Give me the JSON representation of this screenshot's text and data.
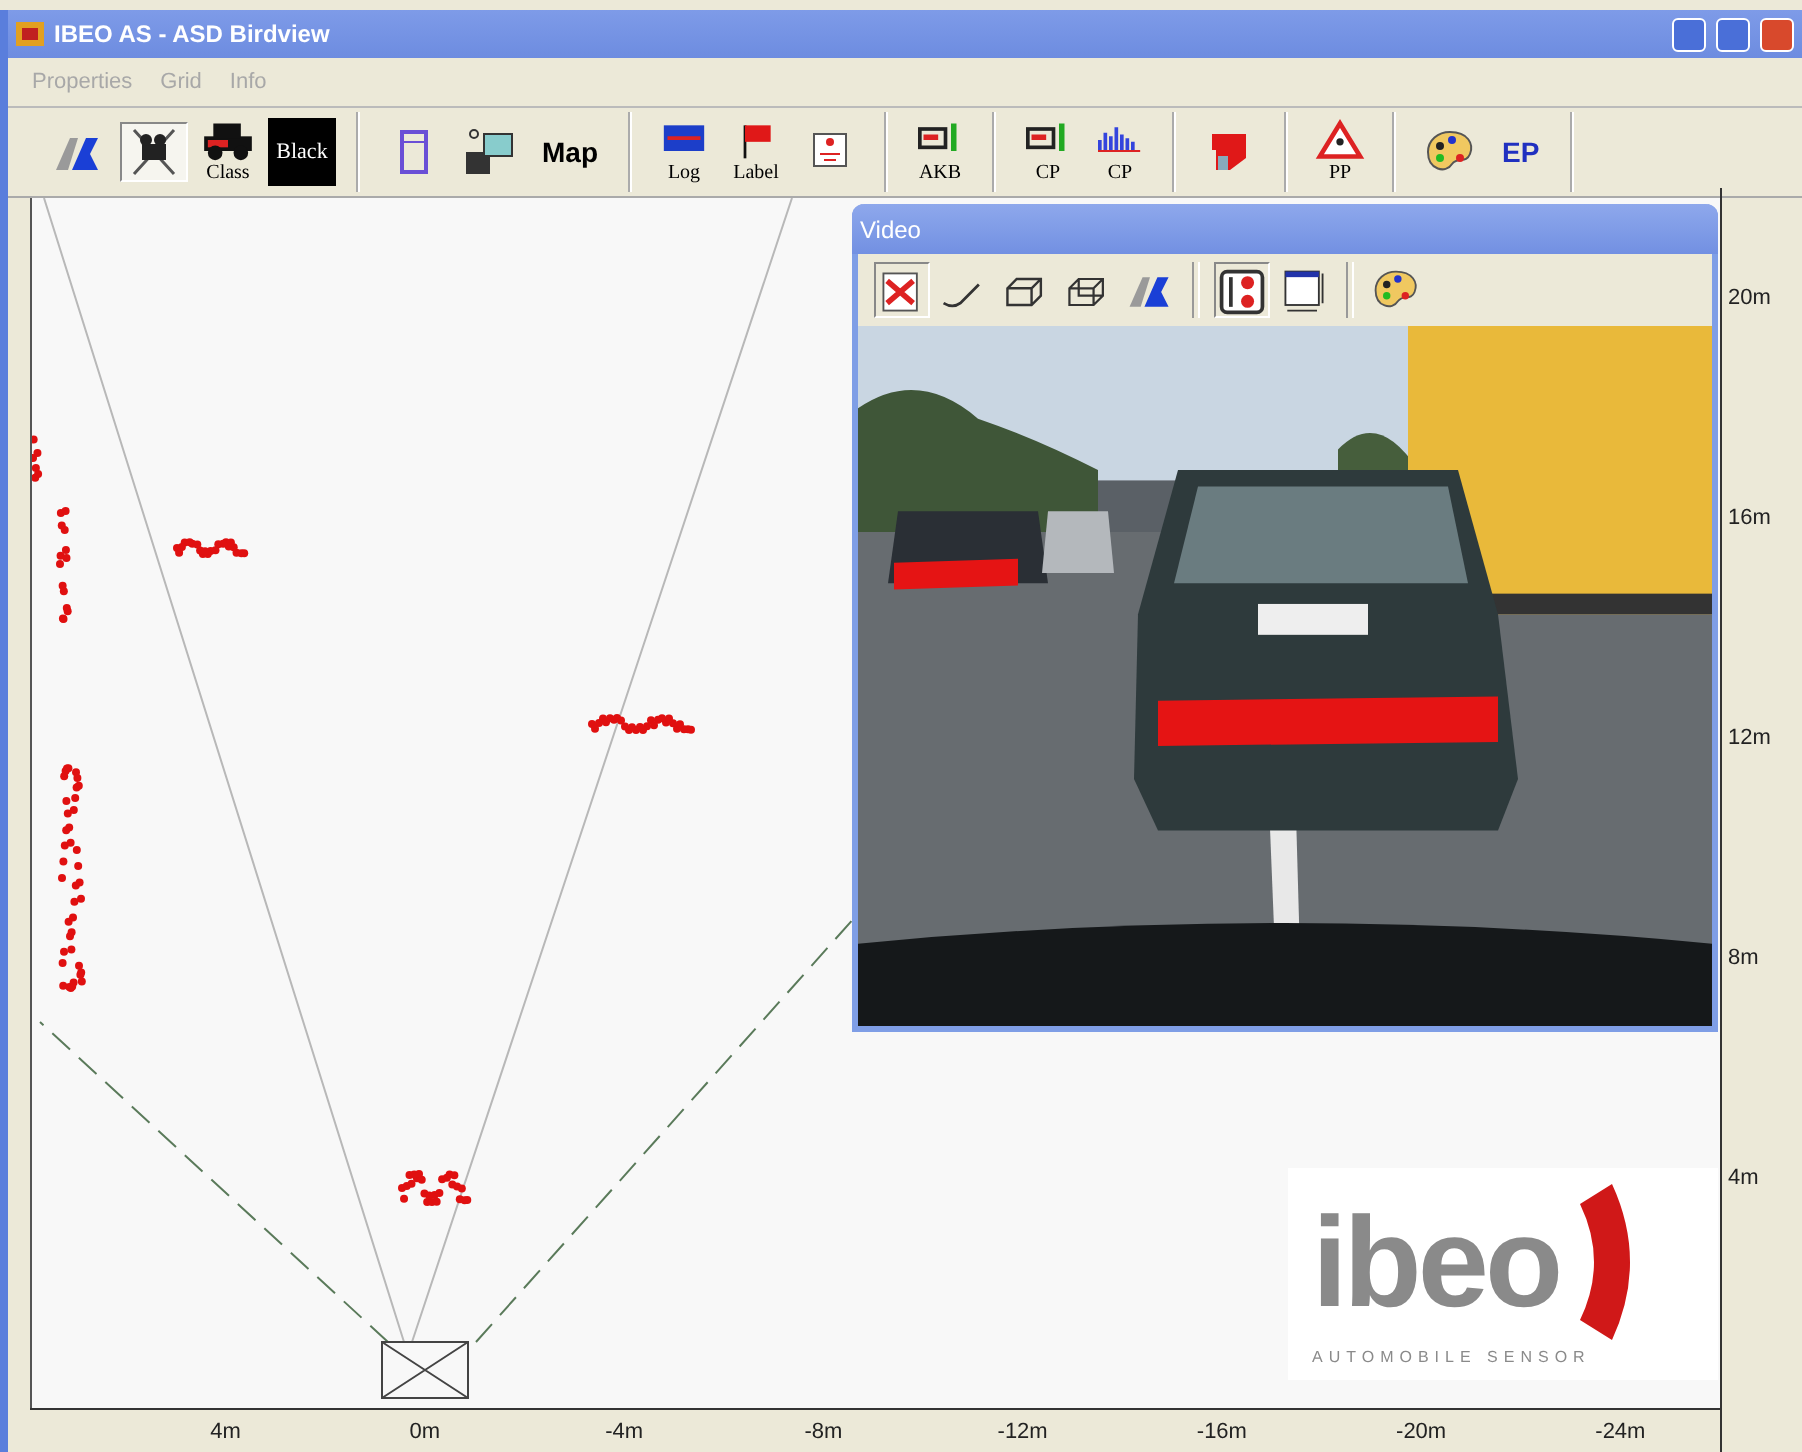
{
  "window": {
    "title": "IBEO AS - ASD Birdview"
  },
  "menu": [
    {
      "label": "Properties"
    },
    {
      "label": "Grid"
    },
    {
      "label": "Info"
    }
  ],
  "toolbar": {
    "groups": [
      [
        {
          "kind": "icon",
          "selected": false
        },
        {
          "kind": "icon",
          "selected": true
        },
        {
          "kind": "labeled",
          "label": "Class",
          "selected": false
        },
        {
          "kind": "swatch",
          "label": "Black"
        }
      ],
      [
        {
          "kind": "icon",
          "selected": false
        },
        {
          "kind": "icon",
          "selected": false
        },
        {
          "kind": "text",
          "label": "Map"
        }
      ],
      [
        {
          "kind": "labeled",
          "label": "Log",
          "selected": false
        },
        {
          "kind": "labeled",
          "label": "Label",
          "selected": false
        },
        {
          "kind": "icon",
          "selected": false
        }
      ],
      [
        {
          "kind": "labeled",
          "label": "AKB",
          "selected": false
        }
      ],
      [
        {
          "kind": "labeled",
          "label": "CP",
          "selected": false
        },
        {
          "kind": "labeled",
          "label": "CP",
          "selected": false
        }
      ],
      [
        {
          "kind": "icon",
          "selected": false
        }
      ],
      [
        {
          "kind": "labeled",
          "label": "PP",
          "selected": false
        }
      ],
      [
        {
          "kind": "icon",
          "selected": false
        },
        {
          "kind": "text",
          "label": "EP"
        }
      ]
    ]
  },
  "video": {
    "title": "Video",
    "tools": [
      {
        "kind": "icon",
        "selected": true
      },
      {
        "kind": "icon",
        "selected": false
      },
      {
        "kind": "icon",
        "selected": false
      },
      {
        "kind": "icon",
        "selected": false
      },
      {
        "kind": "icon",
        "selected": false
      },
      {
        "kind": "separator"
      },
      {
        "kind": "icon",
        "selected": true
      },
      {
        "kind": "icon",
        "selected": false
      },
      {
        "kind": "separator"
      },
      {
        "kind": "icon",
        "selected": false
      }
    ]
  },
  "logo": {
    "name": "ibeo",
    "tagline": "AUTOMOBILE SENSOR"
  },
  "x_axis": [
    "4m",
    "0m",
    "-4m",
    "-8m",
    "-12m",
    "-16m",
    "-20m",
    "-24m"
  ],
  "y_axis": [
    "20m",
    "16m",
    "12m",
    "8m",
    "4m"
  ]
}
